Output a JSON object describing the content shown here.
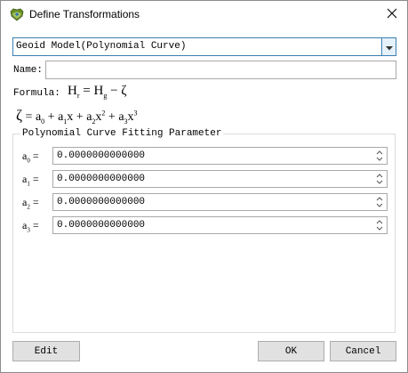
{
  "window": {
    "title": "Define Transformations",
    "close_icon": "close-icon",
    "app_icon": "geoid-app-icon"
  },
  "model_select": {
    "value": "Geoid Model(Polynomial Curve)",
    "arrow_icon": "chevron-down-icon"
  },
  "name_field": {
    "label": "Name:",
    "value": ""
  },
  "formula": {
    "label": "Formula:",
    "H1": "H",
    "H1_sub": "r",
    "eq": "=",
    "H2": "H",
    "H2_sub": "g",
    "minus": "−",
    "zeta": "ζ"
  },
  "zeta_formula": {
    "zeta": "ζ",
    "eq": "=",
    "t0": "a",
    "t0_sub": "0",
    "plus1": "+",
    "t1": "a",
    "t1_sub": "1",
    "t1_var": "x",
    "plus2": "+",
    "t2": "a",
    "t2_sub": "2",
    "t2_var": "x",
    "t2_sup": "2",
    "plus3": "+",
    "t3": "a",
    "t3_sub": "3",
    "t3_var": "x",
    "t3_sup": "3"
  },
  "group": {
    "title": "Polynomial Curve Fitting Parameter",
    "params": [
      {
        "label": "a",
        "sub": "0",
        "eq": "=",
        "value": "0.0000000000000"
      },
      {
        "label": "a",
        "sub": "1",
        "eq": "=",
        "value": "0.0000000000000"
      },
      {
        "label": "a",
        "sub": "2",
        "eq": "=",
        "value": "0.0000000000000"
      },
      {
        "label": "a",
        "sub": "3",
        "eq": "=",
        "value": "0.0000000000000"
      }
    ]
  },
  "buttons": {
    "edit": "Edit",
    "ok": "OK",
    "cancel": "Cancel"
  },
  "colors": {
    "focus_border": "#3c7fb1",
    "button_face": "#e1e1e1",
    "combo_button": "#e5f1fb"
  }
}
